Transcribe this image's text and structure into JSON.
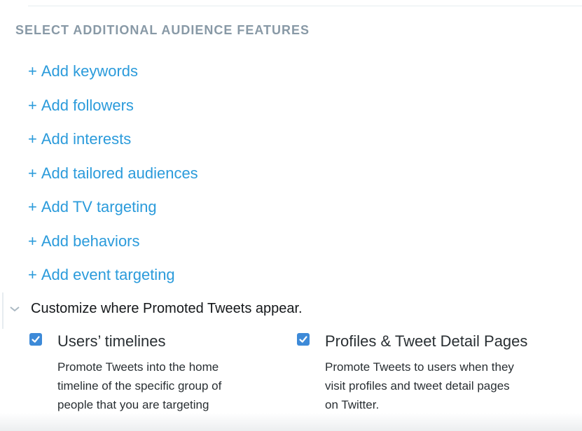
{
  "section": {
    "heading": "SELECT ADDITIONAL AUDIENCE FEATURES"
  },
  "features": [
    {
      "plus": "+",
      "label": "Add keywords"
    },
    {
      "plus": "+",
      "label": "Add followers"
    },
    {
      "plus": "+",
      "label": "Add interests"
    },
    {
      "plus": "+",
      "label": "Add tailored audiences"
    },
    {
      "plus": "+",
      "label": "Add TV targeting"
    },
    {
      "plus": "+",
      "label": "Add behaviors"
    },
    {
      "plus": "+",
      "label": "Add event targeting"
    }
  ],
  "customize": {
    "heading": "Customize where Promoted Tweets appear.",
    "toggle_icon": "caret-down-icon",
    "placements": [
      {
        "label": "Users’ timelines",
        "checked": true,
        "description_lines": [
          "Promote Tweets into the home",
          "timeline of the specific group of",
          "people that you are targeting"
        ]
      },
      {
        "label": "Profiles & Tweet Detail Pages",
        "checked": true,
        "description_lines": [
          "Promote Tweets to users when they",
          "visit profiles and tweet detail pages",
          "on Twitter."
        ]
      }
    ]
  },
  "colors": {
    "link": "#2b9bdb",
    "heading_muted": "#8899a6",
    "checkbox": "#3d8ad8",
    "text": "#292f33"
  }
}
